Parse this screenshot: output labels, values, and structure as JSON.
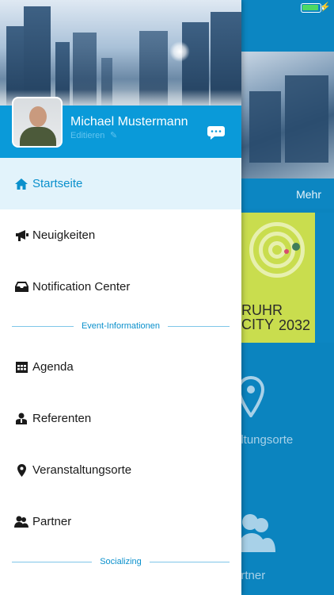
{
  "status_bar": {
    "battery_icon": "battery-full-icon",
    "charging_icon": "charging-bolt-icon"
  },
  "background_app": {
    "more_label": "Mehr",
    "poster_text": "RUHR CITY",
    "poster_year": "2032",
    "venue_tile_label": "altungsorte",
    "partner_tile_label": "artner"
  },
  "profile": {
    "name": "Michael Mustermann",
    "edit_label": "Editieren",
    "chat_icon": "chat-bubbles-icon"
  },
  "menu": {
    "items": [
      {
        "label": "Startseite",
        "icon": "home-icon",
        "active": true
      },
      {
        "label": "Neuigkeiten",
        "icon": "megaphone-icon"
      },
      {
        "label": "Notification Center",
        "icon": "inbox-tray-icon"
      }
    ],
    "section_event": "Event-Informationen",
    "event_items": [
      {
        "label": "Agenda",
        "icon": "calendar-icon"
      },
      {
        "label": "Referenten",
        "icon": "speaker-person-icon"
      },
      {
        "label": "Veranstaltungsorte",
        "icon": "map-pin-icon"
      },
      {
        "label": "Partner",
        "icon": "partner-people-icon"
      }
    ],
    "section_social": "Socializing"
  },
  "colors": {
    "accent": "#0a9ad9",
    "active_bg": "#e2f3fb",
    "background_app": "#0b84bf"
  }
}
